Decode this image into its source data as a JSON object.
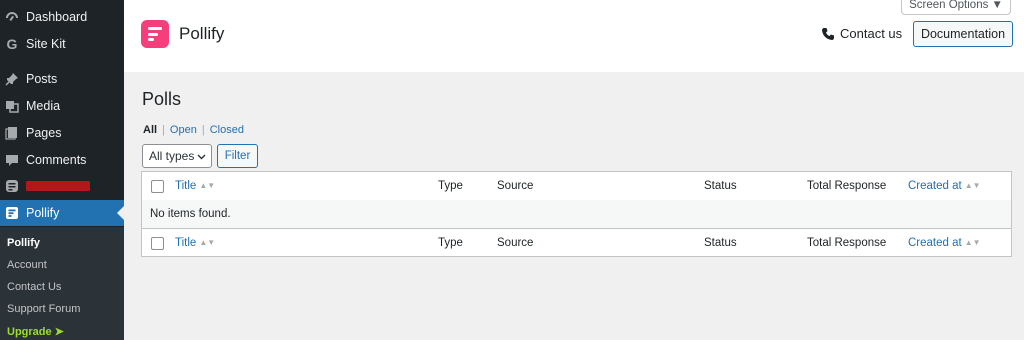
{
  "sidebar": {
    "menu": [
      {
        "label": "Dashboard",
        "icon": "dashboard-icon"
      },
      {
        "label": "Site Kit",
        "icon": "site-kit-g-icon"
      },
      {
        "label": "Posts",
        "icon": "pin-icon"
      },
      {
        "label": "Media",
        "icon": "media-icon"
      },
      {
        "label": "Pages",
        "icon": "pages-icon"
      },
      {
        "label": "Comments",
        "icon": "comment-icon"
      },
      {
        "label": "",
        "icon": "form-icon"
      },
      {
        "label": "Pollify",
        "icon": "pollify-icon"
      }
    ],
    "submenu": [
      "Pollify",
      "Account",
      "Contact Us",
      "Support Forum",
      "Upgrade ➤"
    ]
  },
  "header": {
    "brand": "Pollify",
    "contact_label": "Contact us",
    "documentation_label": "Documentation",
    "screen_options_label": "Screen Options ▼"
  },
  "page": {
    "title": "Polls",
    "views": [
      "All",
      "Open",
      "Closed"
    ],
    "views_separator": "|",
    "type_filter": "All types",
    "filter_button": "Filter"
  },
  "table": {
    "columns": [
      "Title",
      "Type",
      "Source",
      "Status",
      "Total Response",
      "Created at"
    ],
    "empty_message": "No items found.",
    "sort_glyph": "▲▼"
  },
  "colors": {
    "accent": "#2271b1",
    "brand": "#f43f7c",
    "sidebar_bg": "#1d2327",
    "upgrade": "#9bde2b"
  }
}
